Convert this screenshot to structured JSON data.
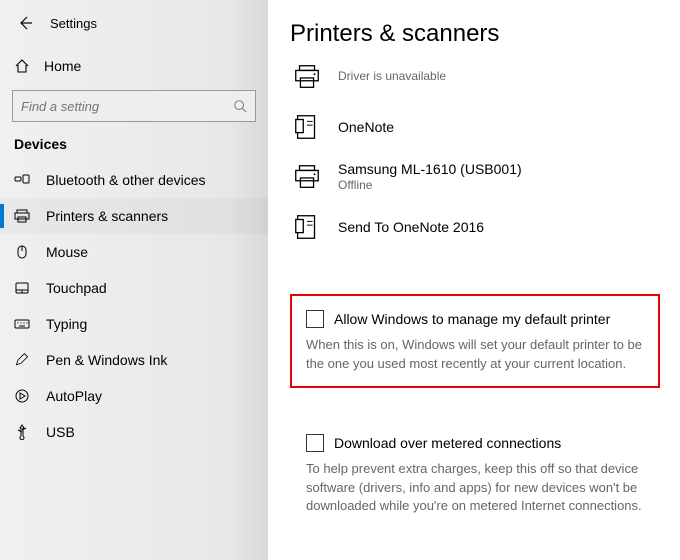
{
  "header": {
    "title": "Settings"
  },
  "home_label": "Home",
  "search": {
    "placeholder": "Find a setting"
  },
  "group_label": "Devices",
  "sidebar": {
    "items": [
      {
        "label": "Bluetooth & other devices"
      },
      {
        "label": "Printers & scanners"
      },
      {
        "label": "Mouse"
      },
      {
        "label": "Touchpad"
      },
      {
        "label": "Typing"
      },
      {
        "label": "Pen & Windows Ink"
      },
      {
        "label": "AutoPlay"
      },
      {
        "label": "USB"
      }
    ]
  },
  "main": {
    "title": "Printers & scanners",
    "devices": [
      {
        "name": "",
        "status": "Driver is unavailable"
      },
      {
        "name": "OneNote",
        "status": ""
      },
      {
        "name": "Samsung ML-1610 (USB001)",
        "status": "Offline"
      },
      {
        "name": "Send To OneNote 2016",
        "status": ""
      }
    ],
    "opt1": {
      "label": "Allow Windows to manage my default printer",
      "desc": "When this is on, Windows will set your default printer to be the one you used most recently at your current location."
    },
    "opt2": {
      "label": "Download over metered connections",
      "desc": "To help prevent extra charges, keep this off so that device software (drivers, info and apps) for new devices won't be downloaded while you're on metered Internet connections."
    }
  }
}
